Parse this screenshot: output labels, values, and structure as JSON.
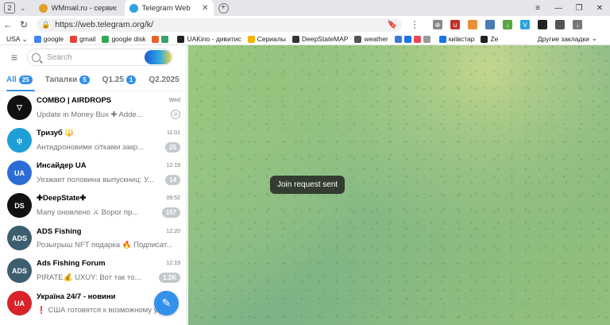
{
  "browser": {
    "tab_count": "2",
    "tabs": [
      {
        "title": "WMmail.ru - сервис почто",
        "color": "#e2a02a"
      },
      {
        "title": "Telegram Web",
        "color": "#2aa3df"
      }
    ],
    "url": "https://web.telegram.org/k/"
  },
  "bookmarks": {
    "items": [
      {
        "label": "USA",
        "color": "#ffffff"
      },
      {
        "label": "google",
        "color": "#4285f4"
      },
      {
        "label": "gmail",
        "color": "#ea4335"
      },
      {
        "label": "google disk",
        "color": "#34a853"
      },
      {
        "label": "UAKino - дивитис",
        "color": "#222222"
      },
      {
        "label": "Сериалы",
        "color": "#f4b400"
      },
      {
        "label": "DeepStateMAP",
        "color": "#333333"
      },
      {
        "label": "weather",
        "color": "#555555"
      },
      {
        "label": "київстар",
        "color": "#1a73e8"
      },
      {
        "label": "Ze",
        "color": "#222222"
      }
    ],
    "other_label": "Другие закладки"
  },
  "telegram": {
    "search_placeholder": "Search",
    "folders": [
      {
        "label": "All",
        "count": "25"
      },
      {
        "label": "Тапалки",
        "count": "5"
      },
      {
        "label": "Q1.25",
        "count": "1"
      },
      {
        "label": "Q2.2025",
        "count": ""
      }
    ],
    "chats": [
      {
        "name": "COMBO | AIRDROPS",
        "time": "Wed",
        "message": "Update in Money Bux ✚ Adde...",
        "badge": "",
        "avatar_bg": "#111111",
        "avatar_text": "▽",
        "pinned": true
      },
      {
        "name": "Тризуб 🔱",
        "time": "11:01",
        "message": "Антидронoвими сітками закр...",
        "badge": "25",
        "avatar_bg": "#1f9fd6",
        "avatar_text": "ψ",
        "pinned": false
      },
      {
        "name": "Инсайдер UA",
        "time": "12:19",
        "message": "Уезжает половина выпускниц: У...",
        "badge": "14",
        "avatar_bg": "#2c6dd5",
        "avatar_text": "UA",
        "pinned": false
      },
      {
        "name": "✚DeepState✚",
        "time": "09:52",
        "message": "Мапу оновлено ⚔ Ворог пр...",
        "badge": "157",
        "avatar_bg": "#111111",
        "avatar_text": "DS",
        "pinned": false
      },
      {
        "name": "ADS Fishing",
        "time": "12:20",
        "message": "Розыгрыш NFT подарка 🔥 Подписат...",
        "badge": "",
        "avatar_bg": "#3d5e6e",
        "avatar_text": "ADS",
        "pinned": false
      },
      {
        "name": "Ads Fishing Forum",
        "time": "12:19",
        "message": "PIRATE💰 UXUY: Вот так то...",
        "badge": "1.2K",
        "avatar_bg": "#3d5e6e",
        "avatar_text": "ADS",
        "pinned": false
      },
      {
        "name": "Україна 24/7 - новини",
        "time": "",
        "message": "❗ США готовятся к возможному у...",
        "badge": "",
        "avatar_bg": "#d8232a",
        "avatar_text": "UA",
        "pinned": false
      }
    ]
  },
  "toast": "Join request sent"
}
